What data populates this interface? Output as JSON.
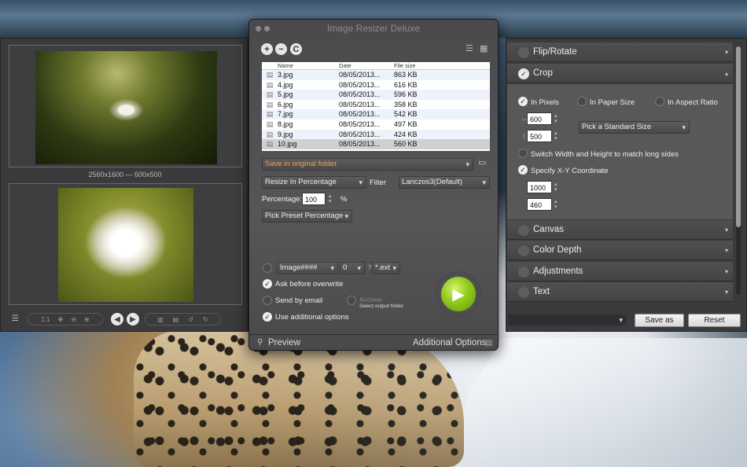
{
  "app": {
    "title": "Image Resizer Deluxe"
  },
  "left": {
    "dims": "2560x1600 — 600x500",
    "toolbar": {
      "zoom_actual": "1:1"
    }
  },
  "main": {
    "files": {
      "headers": [
        "Name",
        "Date",
        "File size"
      ],
      "rows": [
        {
          "name": "3.jpg",
          "date": "08/05/2013...",
          "size": "863 KB"
        },
        {
          "name": "4.jpg",
          "date": "08/05/2013...",
          "size": "616 KB"
        },
        {
          "name": "5.jpg",
          "date": "08/05/2013...",
          "size": "596 KB"
        },
        {
          "name": "6.jpg",
          "date": "08/05/2013...",
          "size": "358 KB"
        },
        {
          "name": "7.jpg",
          "date": "08/05/2013...",
          "size": "542 KB"
        },
        {
          "name": "8.jpg",
          "date": "08/05/2013...",
          "size": "497 KB"
        },
        {
          "name": "9.jpg",
          "date": "08/05/2013...",
          "size": "424 KB"
        },
        {
          "name": "10.jpg",
          "date": "08/05/2013...",
          "size": "560 KB"
        }
      ]
    },
    "output_folder": "Save in original folder",
    "resize_mode": "Resize In Percentage",
    "filter_label": "Filter",
    "filter_value": "Lanczos3(Default)",
    "percentage_label": "Percentage:",
    "percentage_value": "100",
    "percent_sign": "%",
    "preset": "Pick Preset Percentage",
    "rename_pattern": "Image####",
    "rename_start": "0",
    "rename_q": "?",
    "rename_ext": "*.ext",
    "ask_overwrite": "Ask before overwrite",
    "send_email": "Send by email",
    "archive": "Archive",
    "select_output": "Select output folder",
    "use_additional": "Use additional options",
    "preview": "Preview",
    "additional_options": "Additional Options"
  },
  "right": {
    "sections": {
      "flip": "Flip/Rotate",
      "crop": "Crop",
      "canvas": "Canvas",
      "color_depth": "Color Depth",
      "adjustments": "Adjustments",
      "text": "Text"
    },
    "crop": {
      "in_pixels": "In Pixels",
      "in_paper": "In Paper Size",
      "in_aspect": "In Aspect Ratio",
      "width": "600",
      "height": "500",
      "standard_size": "Pick a Standard Size",
      "switch_wh": "Switch Width and Height to match long sides",
      "specify_xy": "Specify X-Y Coordinate",
      "x": "1000",
      "y": "460"
    },
    "save_as": "Save as",
    "reset": "Reset"
  },
  "colors": {
    "accent_orange": "#f0a24a",
    "go_green": "#8fca1b"
  }
}
